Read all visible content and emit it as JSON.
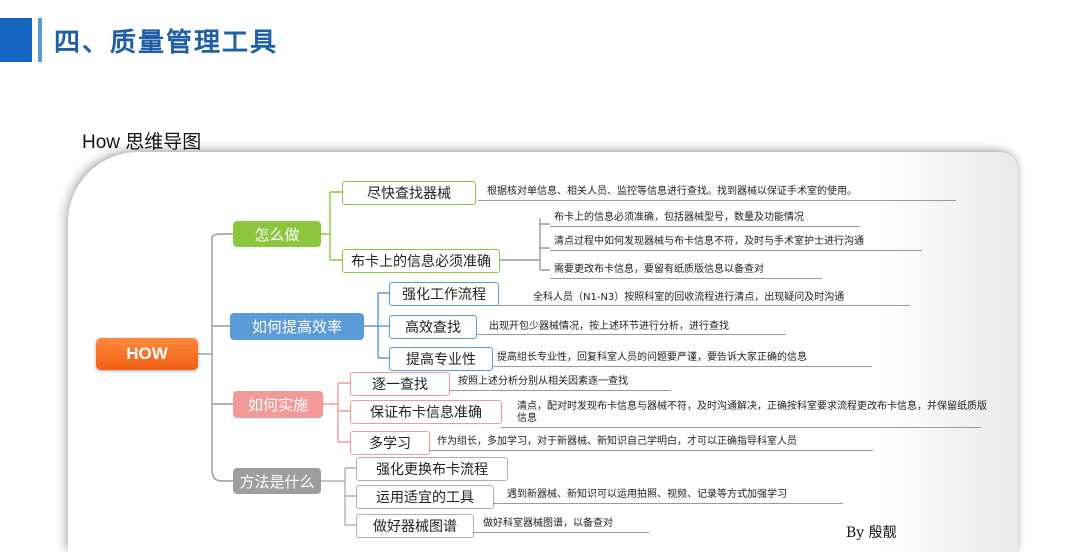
{
  "header": {
    "title": "四、质量管理工具"
  },
  "subtitle": "How 思维导图",
  "mindmap": {
    "root": "HOW",
    "branches": [
      {
        "label": "怎么做",
        "color": "#8cc63f",
        "children": [
          {
            "label": "尽快查找器械",
            "details": [
              "根据核对单信息、相关人员、监控等信息进行查找。找到器械以保证手术室的使用。"
            ]
          },
          {
            "label": "布卡上的信息必须准确",
            "details": [
              "布卡上的信息必须准确，包括器械型号，数量及功能情况",
              "清点过程中如何发现器械与布卡信息不符，及时与手术室护士进行沟通",
              "需要更改布卡信息，要留有纸质版信息以备查对"
            ]
          }
        ]
      },
      {
        "label": "如何提高效率",
        "color": "#5a9bd8",
        "children": [
          {
            "label": "强化工作流程",
            "details": [
              "全科人员（N1-N3）按照科室的回收流程进行清点，出现疑问及时沟通"
            ]
          },
          {
            "label": "高效查找",
            "details": [
              "出现开包少器械情况，按上述环节进行分析，进行查找"
            ]
          },
          {
            "label": "提高专业性",
            "details": [
              "提高组长专业性，回复科室人员的问题要严谨，要告诉大家正确的信息"
            ]
          }
        ]
      },
      {
        "label": "如何实施",
        "color": "#f29a9a",
        "children": [
          {
            "label": "逐一查找",
            "details": [
              "按照上述分析分别从相关因素逐一查找"
            ]
          },
          {
            "label": "保证布卡信息准确",
            "details": [
              "清点，配对时发现布卡信息与器械不符，及时沟通解决，正确按科室要求流程更改布卡信息，并保留纸质版信息"
            ]
          },
          {
            "label": "多学习",
            "details": [
              "作为组长，多加学习，对于新器械、新知识自己学明白，才可以正确指导科室人员"
            ]
          }
        ]
      },
      {
        "label": "方法是什么",
        "color": "#9e9e9e",
        "children": [
          {
            "label": "强化更换布卡流程",
            "details": []
          },
          {
            "label": "运用适宜的工具",
            "details": [
              "遇到新器械、新知识可以运用拍照、视频、记录等方式加强学习"
            ]
          },
          {
            "label": "做好器械图谱",
            "details": [
              "做好科室器械图谱，以备查对"
            ]
          }
        ]
      }
    ]
  },
  "author": "By 殷靓",
  "colors": {
    "title_blue": "#1f5fa8",
    "accent_blue": "#1565c0",
    "root_orange": "#f26a1f"
  }
}
